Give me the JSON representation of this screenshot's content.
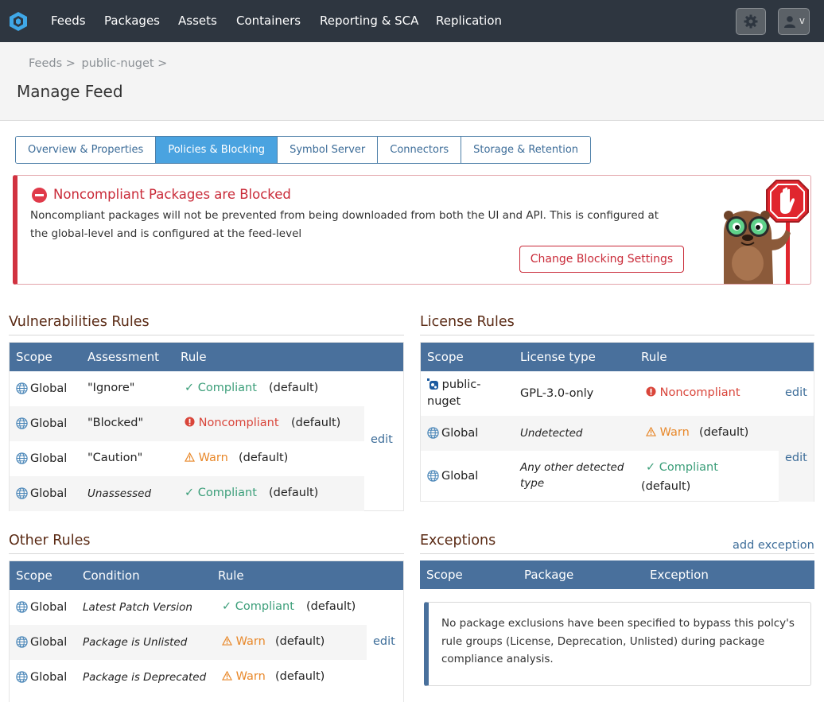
{
  "nav": {
    "items": [
      "Feeds",
      "Packages",
      "Assets",
      "Containers",
      "Reporting & SCA",
      "Replication"
    ],
    "user_caret": "v"
  },
  "header": {
    "breadcrumb": [
      "Feeds >",
      "public-nuget >"
    ],
    "title": "Manage Feed"
  },
  "tabs": [
    {
      "label": "Overview & Properties",
      "active": false
    },
    {
      "label": "Policies & Blocking",
      "active": true
    },
    {
      "label": "Symbol Server",
      "active": false
    },
    {
      "label": "Connectors",
      "active": false
    },
    {
      "label": "Storage & Retention",
      "active": false
    }
  ],
  "alert": {
    "title": "Noncompliant Packages are Blocked",
    "text": "Noncompliant packages will not be prevented from being downloaded from both the UI and API. This is configured at the global-level and is configured at the feed-level",
    "button": "Change Blocking Settings"
  },
  "vulnerabilities": {
    "title": "Vulnerabilities Rules",
    "headers": [
      "Scope",
      "Assessment",
      "Rule"
    ],
    "rows": [
      {
        "scope": "Global",
        "assessment": "\"Ignore\"",
        "rule": "Compliant",
        "suffix": "(default)"
      },
      {
        "scope": "Global",
        "assessment": "\"Blocked\"",
        "rule": "Noncompliant",
        "suffix": "(default)"
      },
      {
        "scope": "Global",
        "assessment": "\"Caution\"",
        "rule": "Warn",
        "suffix": "(default)"
      },
      {
        "scope": "Global",
        "assessment": "Unassessed",
        "rule": "Compliant",
        "suffix": "(default)"
      }
    ],
    "edit": "edit"
  },
  "license": {
    "title": "License Rules",
    "headers": [
      "Scope",
      "License type",
      "Rule"
    ],
    "rows": [
      {
        "scope_line1": "public-",
        "scope_line2": "nuget",
        "type": "GPL-3.0-only",
        "rule": "Noncompliant"
      },
      {
        "scope": "Global",
        "type": "Undetected",
        "rule": "Warn",
        "suffix": "(default)"
      },
      {
        "scope": "Global",
        "type_line1": "Any other detected",
        "type_line2": "type",
        "rule": "Compliant",
        "suffix": "(default)"
      }
    ],
    "edit": "edit"
  },
  "other": {
    "title": "Other Rules",
    "headers": [
      "Scope",
      "Condition",
      "Rule"
    ],
    "rows": [
      {
        "scope": "Global",
        "condition": "Latest Patch Version",
        "rule": "Compliant",
        "suffix": "(default)"
      },
      {
        "scope": "Global",
        "condition": "Package is Unlisted",
        "rule": "Warn",
        "suffix": "(default)"
      },
      {
        "scope": "Global",
        "condition": "Package is Deprecated",
        "rule": "Warn",
        "suffix": "(default)"
      }
    ],
    "edit": "edit"
  },
  "exceptions": {
    "title": "Exceptions",
    "add": "add exception",
    "headers": [
      "Scope",
      "Package",
      "Exception"
    ],
    "empty_text": "No package exclusions have been specified to bypass this polcy's rule groups (License, Deprecation, Unlisted) during package compliance analysis."
  },
  "colors": {
    "nav_bg": "#2e3640",
    "table_header": "#49709c",
    "compliant": "#3b9e79",
    "noncompliant": "#d9453a",
    "warn": "#e8882a",
    "alert": "#d13240"
  }
}
